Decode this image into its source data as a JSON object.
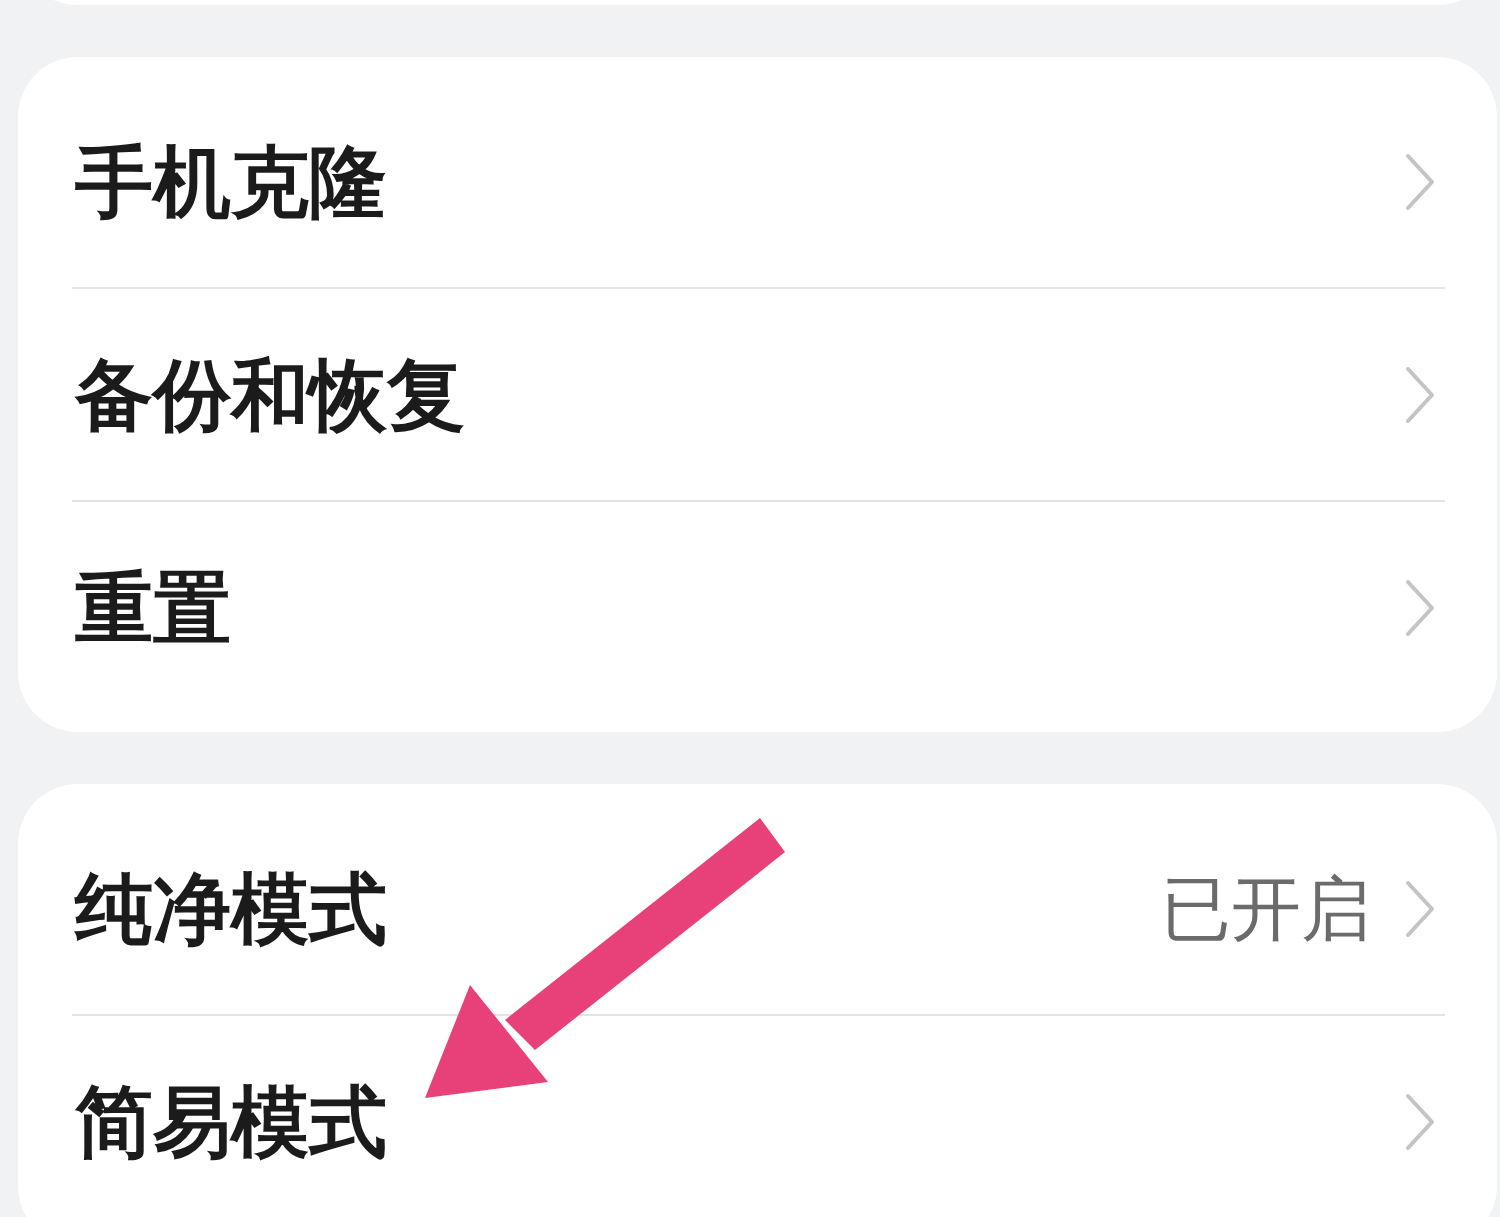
{
  "groups": [
    {
      "items": [
        {
          "label": "手机克隆"
        },
        {
          "label": "备份和恢复"
        },
        {
          "label": "重置"
        }
      ]
    },
    {
      "items": [
        {
          "label": "纯净模式",
          "value": "已开启"
        },
        {
          "label": "简易模式"
        }
      ]
    }
  ],
  "annotation": {
    "kind": "arrow"
  }
}
